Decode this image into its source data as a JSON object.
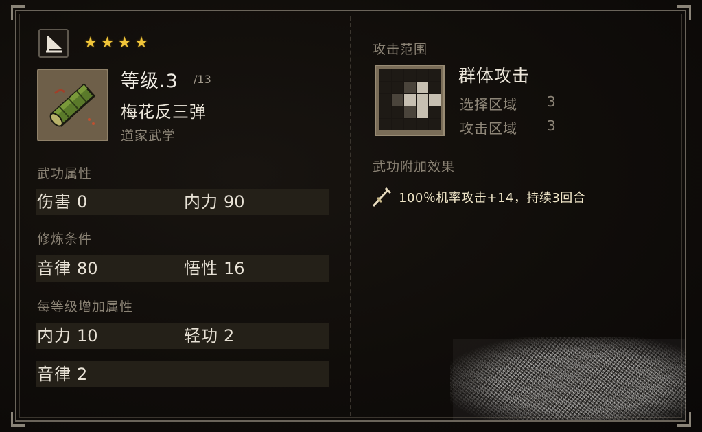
{
  "header": {
    "stars": [
      "★",
      "★",
      "★",
      "★"
    ],
    "type_icon": "book-flag-icon"
  },
  "skill": {
    "icon": "scroll-icon",
    "level_label": "等级.3",
    "level_max": "/13",
    "name": "梅花反三弹",
    "school": "道家武学"
  },
  "sections": {
    "attributes_title": "武功属性",
    "attributes": [
      {
        "label": "伤害",
        "value": "0"
      },
      {
        "label": "内力",
        "value": "90"
      }
    ],
    "requirements_title": "修炼条件",
    "requirements": [
      {
        "label": "音律",
        "value": "80"
      },
      {
        "label": "悟性",
        "value": "16"
      }
    ],
    "per_level_title": "每等级增加属性",
    "per_level": [
      {
        "label": "内力",
        "value": "10"
      },
      {
        "label": "轻功",
        "value": "2"
      },
      {
        "label": "音律",
        "value": "2"
      }
    ]
  },
  "range": {
    "title": "攻击范围",
    "attack_type": "群体攻击",
    "select_area_label": "选择区域",
    "select_area_value": "3",
    "attack_area_label": "攻击区域",
    "attack_area_value": "3",
    "grid": [
      [
        0,
        0,
        0,
        0,
        0
      ],
      [
        0,
        0,
        1,
        2,
        0
      ],
      [
        0,
        1,
        2,
        2,
        2
      ],
      [
        0,
        0,
        1,
        2,
        0
      ],
      [
        0,
        0,
        0,
        0,
        0
      ]
    ]
  },
  "effects": {
    "title": "武功附加效果",
    "icon": "sword-icon",
    "text": "100％机率攻击+14，持续3回合"
  },
  "colors": {
    "star": "#f0c53a",
    "effect_text": "#f0e6c8",
    "row_bg": "#242018"
  }
}
